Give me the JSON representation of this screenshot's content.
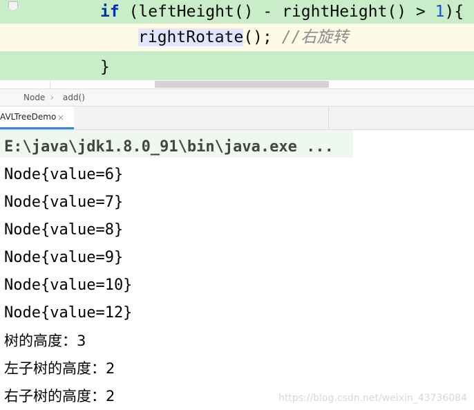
{
  "editor": {
    "line1": {
      "kw": "if",
      "rest_a": " (leftHeight() - rightHeight() > ",
      "num": "1",
      "rest_b": "){"
    },
    "line2": {
      "call": "rightRotate",
      "rest": "(); ",
      "comment": "//右旋转"
    },
    "line3": {
      "text": "}"
    }
  },
  "breadcrumb": {
    "items": [
      "Node",
      "add()"
    ],
    "separator": "›"
  },
  "run_panel": {
    "tab_label": "AVLTreeDemo",
    "close_glyph": "×"
  },
  "console": {
    "command": "E:\\java\\jdk1.8.0_91\\bin\\java.exe ...",
    "lines": [
      "Node{value=6}",
      "Node{value=7}",
      "Node{value=8}",
      "Node{value=9}",
      "Node{value=10}",
      "Node{value=12}",
      "树的高度：3",
      "左子树的高度：2",
      "右子树的高度：2"
    ]
  },
  "watermark": "https://blog.csdn.net/weixin_43736084"
}
